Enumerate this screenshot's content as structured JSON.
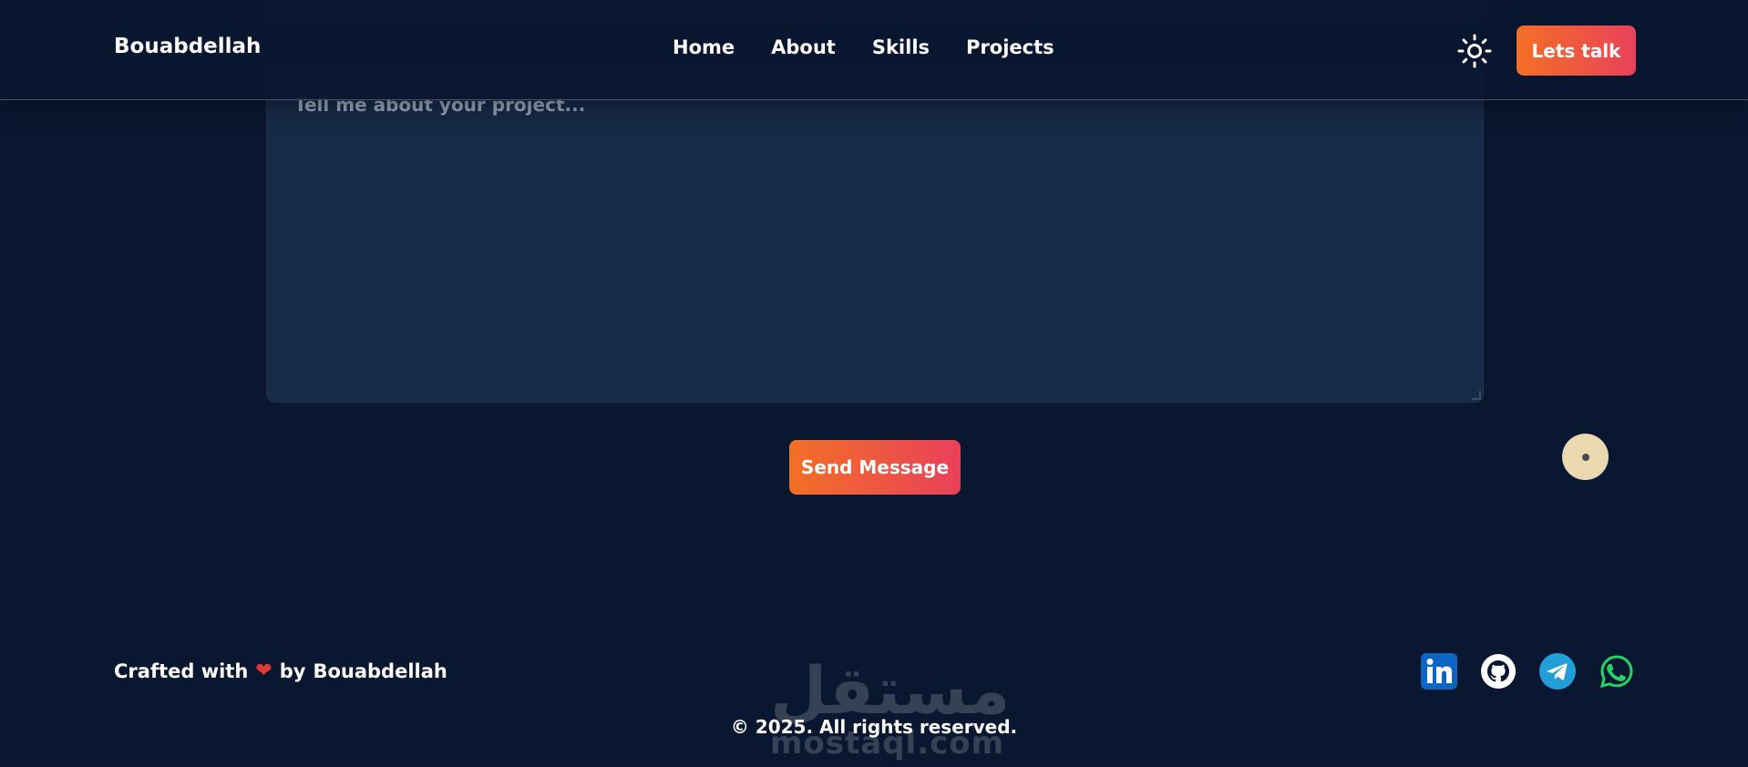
{
  "header": {
    "brand": "Bouabdellah",
    "nav": [
      "Home",
      "About",
      "Skills",
      "Projects"
    ],
    "cta_label": "Lets talk"
  },
  "form": {
    "message_placeholder": "Tell me about your project...",
    "send_label": "Send Message"
  },
  "footer": {
    "crafted_prefix": "Crafted with",
    "crafted_by": "by",
    "crafted_name": "Bouabdellah",
    "copyright": "© 2025. All rights reserved.",
    "socials": [
      "linkedin-icon",
      "github-icon",
      "telegram-icon",
      "whatsapp-icon"
    ]
  },
  "watermark": {
    "arabic": "مستقل",
    "latin": "mostaql.com"
  },
  "colors": {
    "background": "#0a1730",
    "panel": "#172a47",
    "accent_start": "#f36f25",
    "accent_end": "#e9415a",
    "linkedin": "#0a66c2",
    "telegram": "#229ed9",
    "whatsapp": "#25d366"
  }
}
